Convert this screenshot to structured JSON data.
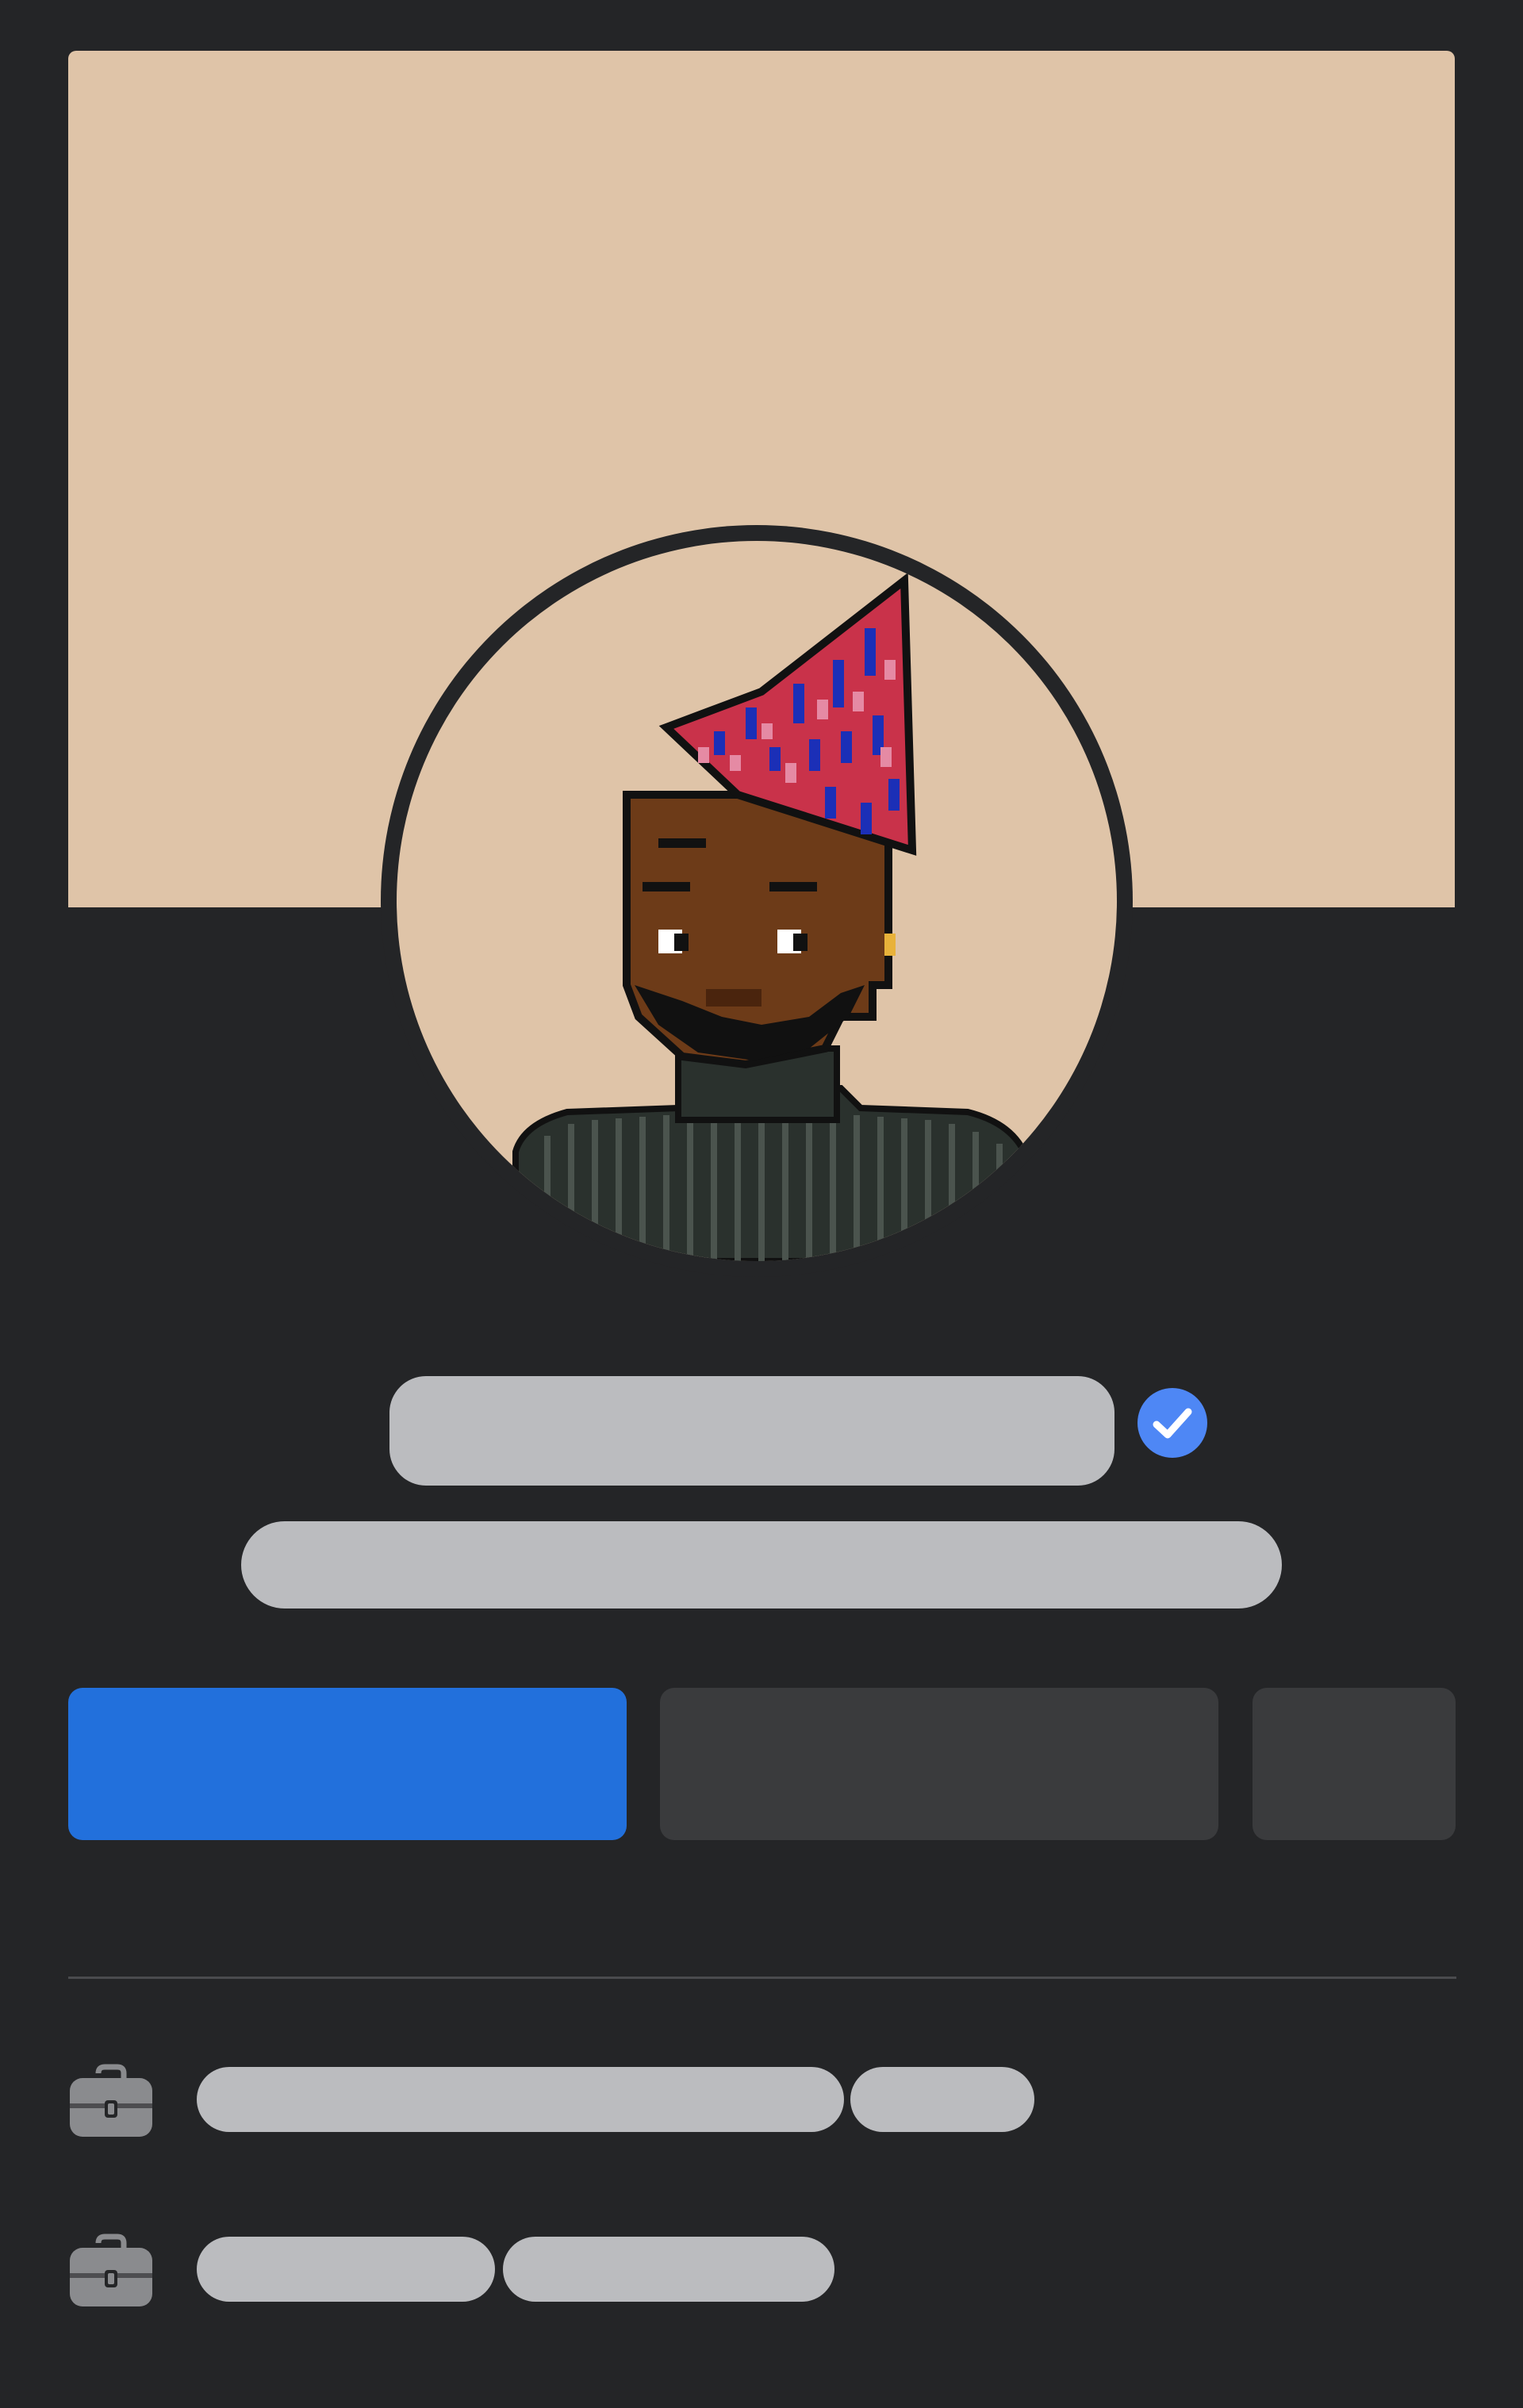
{
  "profile": {
    "cover_color": "#dfc4a8",
    "avatar_background": "#dfc4a8",
    "avatar_icon": "pixel-art-avatar-party-hat",
    "verified_icon": "verified-check-icon",
    "verified_color": "#4e87f5",
    "name": "",
    "bio": ""
  },
  "actions": {
    "primary_label": "",
    "secondary_label": "",
    "more_label": "",
    "primary_color": "#2270dc",
    "secondary_color": "#3a3b3d"
  },
  "details": {
    "icon": "briefcase-icon",
    "rows": [
      {
        "text_a": "",
        "text_b": ""
      },
      {
        "text_a": "",
        "text_b": ""
      }
    ]
  }
}
